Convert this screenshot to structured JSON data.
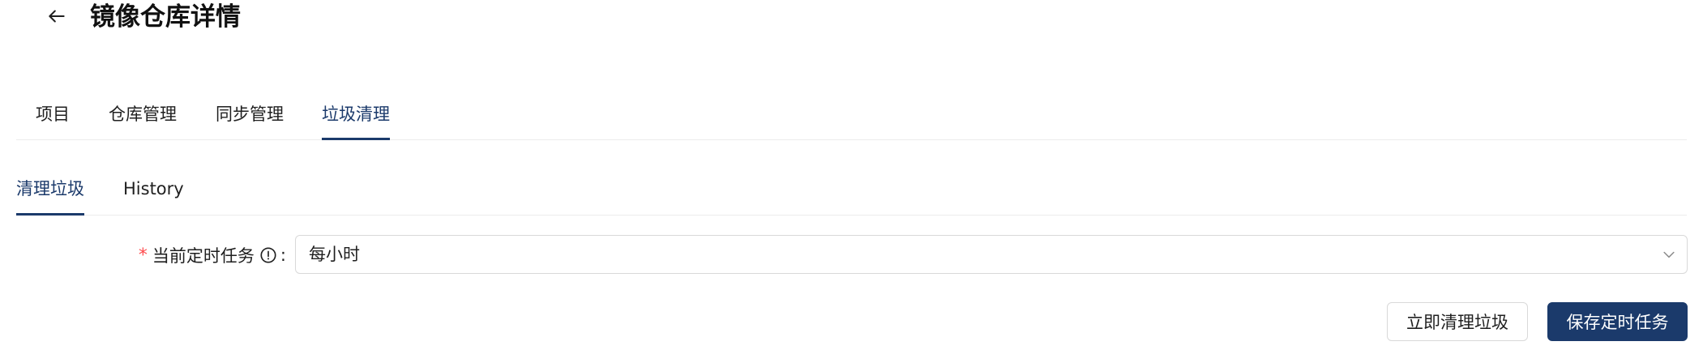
{
  "header": {
    "back_icon": "arrow-left-icon",
    "title": "镜像仓库详情"
  },
  "tabs": [
    {
      "label": "项目",
      "active": false
    },
    {
      "label": "仓库管理",
      "active": false
    },
    {
      "label": "同步管理",
      "active": false
    },
    {
      "label": "垃圾清理",
      "active": true
    }
  ],
  "subtabs": [
    {
      "label": "清理垃圾",
      "active": true
    },
    {
      "label": "History",
      "active": false
    }
  ],
  "form": {
    "required_mark": "*",
    "label": "当前定时任务",
    "info_icon": "exclamation-circle-icon",
    "colon": ":",
    "schedule_value": "每小时",
    "dropdown_icon": "chevron-down-icon"
  },
  "actions": {
    "clean_now_label": "立即清理垃圾",
    "save_schedule_label": "保存定时任务"
  },
  "colors": {
    "primary": "#1b3a6b",
    "required": "#ff4d4f",
    "border": "#d9d9d9"
  }
}
